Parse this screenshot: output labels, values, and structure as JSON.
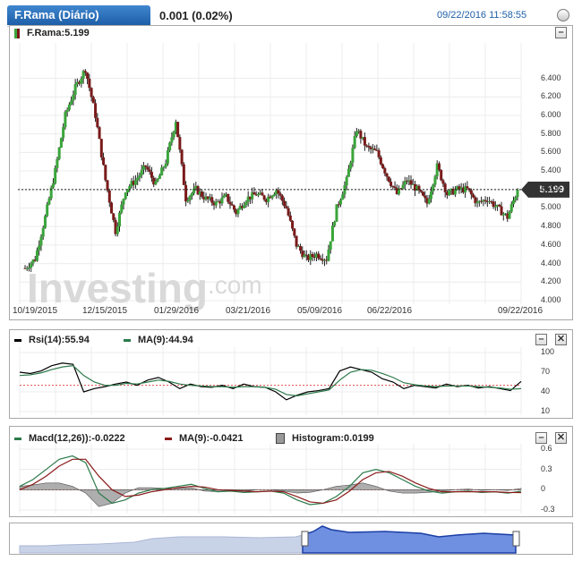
{
  "header": {
    "title": "F.Rama (Diário)",
    "change": "0.001 (0.02%)",
    "datetime": "09/22/2016 11:58:55"
  },
  "colors": {
    "up": "#3aa53a",
    "down": "#7a1a1a",
    "accent": "#1e5fa8",
    "rsi": "#000000",
    "ma": "#2c7a4b",
    "macd": "#2c7a4b",
    "signal": "#8b1a1a",
    "hist": "#888888"
  },
  "main_chart": {
    "legend": "F.Rama:5.199",
    "last_price": "5.199",
    "watermark": "Investing.com"
  },
  "rsi_panel": {
    "rsi_label": "Rsi(14):55.94",
    "ma_label": "MA(9):44.94"
  },
  "macd_panel": {
    "macd_label": "Macd(12,26)):-0.0222",
    "ma_label": "MA(9):-0.0421",
    "hist_label": "Histogram:0.0199"
  },
  "chart_data": [
    {
      "type": "candlestick",
      "title": "F.Rama",
      "y_ticks": [
        "6.400",
        "6.200",
        "6.000",
        "5.800",
        "5.600",
        "5.400",
        "5.200",
        "5.000",
        "4.800",
        "4.600",
        "4.400",
        "4.200",
        "4.000"
      ],
      "ylim": [
        4.0,
        6.55
      ],
      "x_ticks": [
        "10/19/2015",
        "12/15/2015",
        "01/29/2016",
        "03/21/2016",
        "05/09/2016",
        "06/22/2016",
        "09/22/2016"
      ],
      "anchors": [
        4.35,
        4.45,
        4.9,
        5.4,
        6.0,
        6.3,
        6.5,
        6.0,
        5.3,
        4.75,
        5.2,
        5.3,
        5.45,
        5.25,
        5.5,
        5.95,
        5.1,
        5.2,
        5.1,
        5.05,
        5.12,
        4.95,
        5.1,
        5.15,
        5.1,
        5.2,
        5.0,
        4.6,
        4.45,
        4.5,
        4.45,
        5.0,
        5.3,
        5.85,
        5.65,
        5.6,
        5.35,
        5.15,
        5.3,
        5.2,
        5.05,
        5.45,
        5.15,
        5.2,
        5.2,
        5.05,
        5.1,
        5.0,
        4.9,
        5.199
      ],
      "last": 5.199
    },
    {
      "type": "line",
      "title": "Rsi(14)",
      "y_ticks": [
        "100",
        "70",
        "40",
        "10"
      ],
      "ylim": [
        10,
        100
      ],
      "reference_line": 50,
      "series": [
        {
          "name": "Rsi(14)",
          "values": [
            70,
            68,
            72,
            80,
            84,
            82,
            40,
            45,
            48,
            52,
            55,
            50,
            58,
            62,
            55,
            45,
            52,
            48,
            47,
            50,
            45,
            52,
            48,
            47,
            40,
            28,
            35,
            40,
            42,
            45,
            72,
            78,
            74,
            70,
            60,
            55,
            45,
            50,
            48,
            46,
            52,
            48,
            50,
            46,
            48,
            45,
            42,
            55.94
          ]
        },
        {
          "name": "MA(9)",
          "values": [
            65,
            66,
            69,
            74,
            78,
            80,
            65,
            55,
            50,
            50,
            53,
            52,
            55,
            58,
            56,
            52,
            50,
            49,
            48,
            48,
            47,
            48,
            48,
            47,
            44,
            36,
            34,
            37,
            40,
            43,
            58,
            70,
            74,
            73,
            68,
            62,
            54,
            51,
            49,
            48,
            49,
            49,
            49,
            48,
            47,
            46,
            44,
            44.94
          ]
        }
      ]
    },
    {
      "type": "line",
      "title": "Macd(12,26)",
      "y_ticks": [
        "0.6",
        "0.3",
        "0",
        "-0.3"
      ],
      "ylim": [
        -0.3,
        0.6
      ],
      "series": [
        {
          "name": "Macd(12,26)",
          "values": [
            0.05,
            0.15,
            0.3,
            0.45,
            0.5,
            0.4,
            -0.05,
            -0.2,
            -0.15,
            -0.05,
            0.0,
            0.02,
            0.05,
            0.08,
            0.02,
            -0.03,
            -0.02,
            -0.04,
            -0.03,
            -0.02,
            -0.05,
            -0.15,
            -0.22,
            -0.2,
            -0.1,
            0.05,
            0.25,
            0.3,
            0.25,
            0.15,
            0.05,
            -0.02,
            -0.05,
            -0.03,
            -0.02,
            -0.04,
            -0.03,
            -0.05,
            -0.0222
          ]
        },
        {
          "name": "MA(9)",
          "values": [
            0.0,
            0.08,
            0.2,
            0.35,
            0.45,
            0.45,
            0.2,
            0.0,
            -0.1,
            -0.08,
            -0.03,
            0.0,
            0.03,
            0.05,
            0.04,
            0.0,
            -0.01,
            -0.02,
            -0.03,
            -0.02,
            -0.03,
            -0.1,
            -0.18,
            -0.2,
            -0.15,
            -0.02,
            0.15,
            0.25,
            0.27,
            0.2,
            0.1,
            0.02,
            -0.03,
            -0.03,
            -0.03,
            -0.03,
            -0.03,
            -0.04,
            -0.0421
          ]
        },
        {
          "name": "Histogram",
          "values": [
            0.05,
            0.07,
            0.1,
            0.1,
            0.05,
            -0.05,
            -0.25,
            -0.2,
            -0.05,
            0.03,
            0.03,
            0.02,
            0.02,
            0.03,
            -0.02,
            -0.03,
            -0.01,
            -0.02,
            0.0,
            0.0,
            -0.02,
            -0.05,
            -0.04,
            0.0,
            0.05,
            0.07,
            0.1,
            0.05,
            -0.02,
            -0.05,
            -0.05,
            -0.04,
            -0.02,
            0.0,
            0.01,
            -0.01,
            0.0,
            -0.01,
            0.0199
          ]
        }
      ]
    }
  ]
}
